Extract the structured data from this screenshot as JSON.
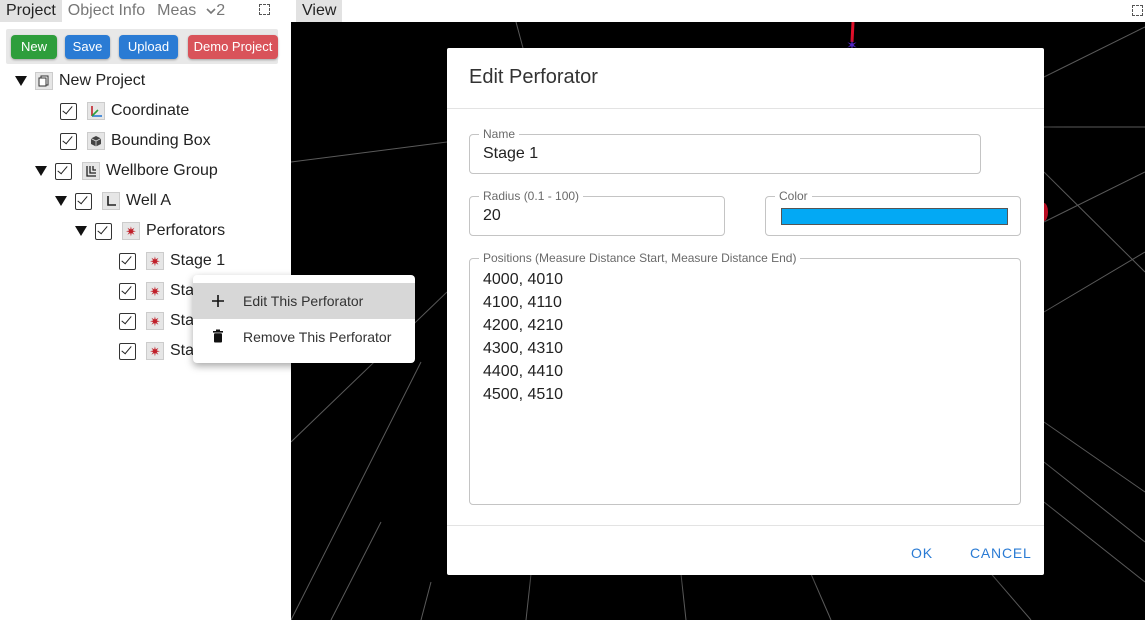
{
  "left_tabs": [
    "Project",
    "Object Info",
    "Meas"
  ],
  "overflow_label": "2",
  "toolbar": {
    "new": "New",
    "save": "Save",
    "upload": "Upload",
    "demo": "Demo Project"
  },
  "tree": {
    "project": "New Project",
    "coordinate": "Coordinate",
    "bounding_box": "Bounding Box",
    "wellbore_group": "Wellbore Group",
    "well": "Well A",
    "perforators": "Perforators",
    "stages": [
      "Stage 1",
      "Sta",
      "Sta",
      "Sta"
    ]
  },
  "view_tab": "View",
  "context_menu": {
    "edit": "Edit This Perforator",
    "remove": "Remove This Perforator"
  },
  "dialog": {
    "title": "Edit Perforator",
    "name_label": "Name",
    "name_value": "Stage 1",
    "radius_label": "Radius (0.1 - 100)",
    "radius_value": "20",
    "color_label": "Color",
    "color_value": "#03a9f4",
    "positions_label": "Positions (Measure Distance Start, Measure Distance End)",
    "positions": [
      "4000, 4010",
      "4100, 4110",
      "4200, 4210",
      "4300, 4310",
      "4400, 4410",
      "4500, 4510"
    ],
    "ok": "OK",
    "cancel": "CANCEL"
  }
}
